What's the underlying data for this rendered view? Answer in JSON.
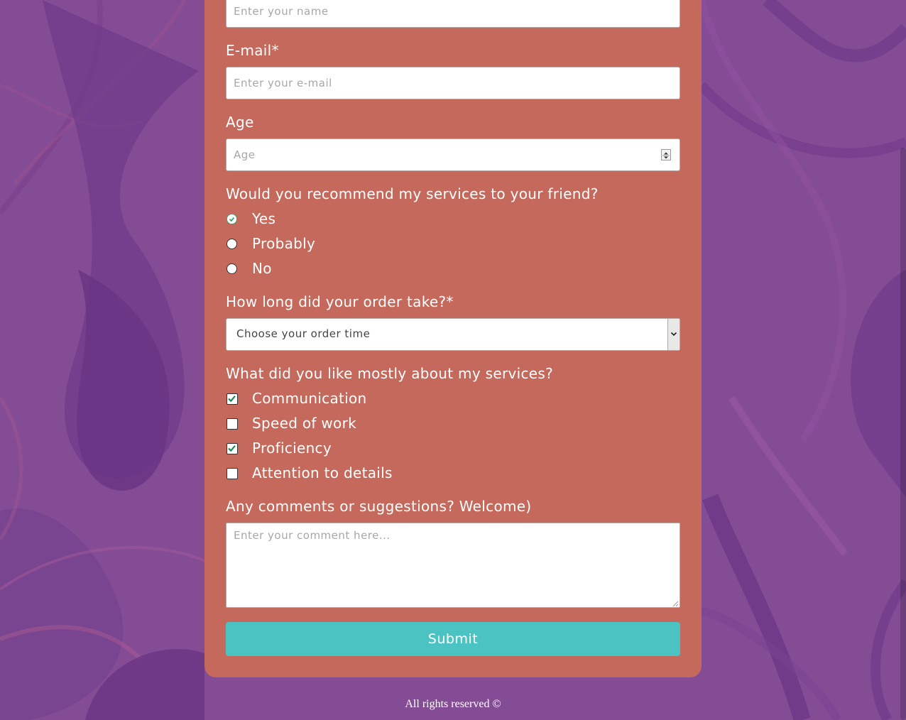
{
  "form": {
    "name": {
      "placeholder": "Enter your name"
    },
    "email": {
      "label": "E-mail*",
      "placeholder": "Enter your e-mail"
    },
    "age": {
      "label": "Age",
      "placeholder": "Age"
    },
    "recommend": {
      "label": "Would you recommend my services to your friend?",
      "options": [
        {
          "label": "Yes",
          "checked": true
        },
        {
          "label": "Probably",
          "checked": false
        },
        {
          "label": "No",
          "checked": false
        }
      ]
    },
    "order_time": {
      "label": "How long did your order take?*",
      "selected": "Choose your order time"
    },
    "liked": {
      "label": "What did you like mostly about my services?",
      "options": [
        {
          "label": "Communication",
          "checked": true
        },
        {
          "label": "Speed of work",
          "checked": false
        },
        {
          "label": "Proficiency",
          "checked": true
        },
        {
          "label": "Attention to details",
          "checked": false
        }
      ]
    },
    "comments": {
      "label": "Any comments or suggestions? Welcome)",
      "placeholder": "Enter your comment here..."
    },
    "submit_label": "Submit"
  },
  "footer": {
    "text": "All rights reserved ©"
  },
  "colors": {
    "background": "#854c96",
    "card": "#c4695b",
    "submit": "#4cc3c3",
    "check_accent": "#1e8a5a"
  }
}
